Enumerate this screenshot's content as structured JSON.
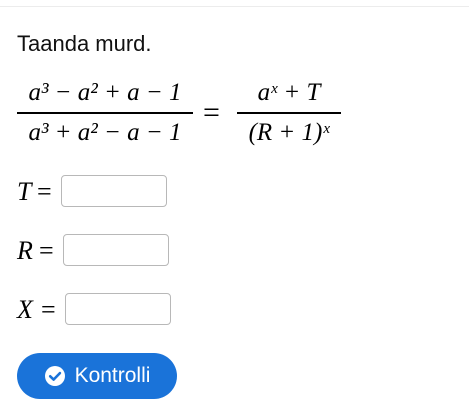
{
  "instruction": "Taanda murd.",
  "equation": {
    "left_numerator": "a³ − a² + a − 1",
    "left_denominator": "a³ + a² − a − 1",
    "equals": "=",
    "right_numerator": "aˣ + T",
    "right_denominator": "(R + 1)ˣ"
  },
  "fields": [
    {
      "label": "T",
      "equals": "=",
      "value": "",
      "placeholder": ""
    },
    {
      "label": "R",
      "equals": "=",
      "value": "",
      "placeholder": ""
    },
    {
      "label": "X",
      "equals": "=",
      "value": "",
      "placeholder": ""
    }
  ],
  "check_button": {
    "label": "Kontrolli",
    "icon": "check-circle-icon"
  },
  "colors": {
    "button_background": "#1a73d9",
    "button_text": "#ffffff",
    "input_border": "#b8b8b8"
  }
}
